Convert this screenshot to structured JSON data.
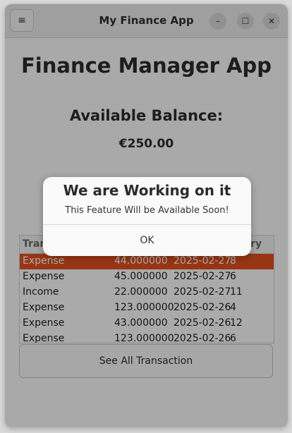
{
  "window": {
    "title": "My Finance App",
    "menu_icon": "≡",
    "minimize_icon": "–",
    "maximize_icon": "☐",
    "close_icon": "✕"
  },
  "app": {
    "heading": "Finance Manager App",
    "balance_label": "Available Balance:",
    "balance_amount": "€250.00"
  },
  "table": {
    "headers": [
      "Tran",
      "",
      "",
      "egory"
    ],
    "rows": [
      [
        "Expense",
        "44.000000",
        "2025-02-27",
        "8"
      ],
      [
        "Expense",
        "45.000000",
        "2025-02-27",
        "6"
      ],
      [
        "Income",
        "22.000000",
        "2025-02-27",
        "11"
      ],
      [
        "Expense",
        "123.000000",
        "2025-02-26",
        "4"
      ],
      [
        "Expense",
        "43.000000",
        "2025-02-26",
        "12"
      ],
      [
        "Expense",
        "123.000000",
        "2025-02-26",
        "6"
      ]
    ],
    "selected_row_color": "#e0501e"
  },
  "see_all_button": "See All Transaction",
  "dialog": {
    "title": "We are Working on it",
    "message": "This Feature Will be Available Soon!",
    "ok_label": "OK"
  }
}
